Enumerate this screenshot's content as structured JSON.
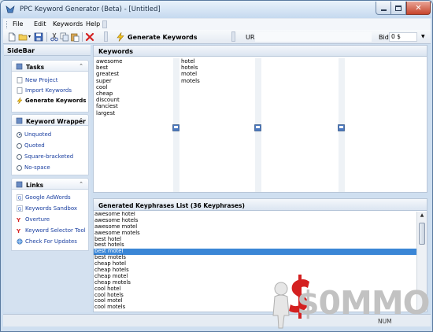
{
  "window": {
    "title": "PPC Keyword Generator (Beta) - [Untitled]"
  },
  "menu": {
    "file": "File",
    "edit": "Edit",
    "keywords": "Keywords",
    "help": "Help"
  },
  "toolbar": {
    "generate_label": "Generate Keywords",
    "url_label": "URL",
    "url_value": "",
    "bid_label": "Bid",
    "bid_value": "0 $"
  },
  "sidebar": {
    "title": "SideBar",
    "tasks": {
      "title": "Tasks",
      "items": [
        "New Project",
        "Import Keywords",
        "Generate Keywords"
      ]
    },
    "wrapper": {
      "title": "Keyword Wrapper",
      "options": [
        "Unquoted",
        "Quoted",
        "Square-bracketed",
        "No-space"
      ],
      "selected": "Unquoted"
    },
    "links": {
      "title": "Links",
      "items": [
        "Google AdWords",
        "Keywords Sandbox",
        "Overture",
        "Keyword Selector Tool",
        "Check For Updates"
      ]
    }
  },
  "keywords": {
    "title": "Keywords",
    "column1": [
      "awesome",
      "best",
      "greatest",
      "super",
      "cool",
      "cheap",
      "discount",
      "fanciest",
      "largest"
    ],
    "column2": [
      "hotel",
      "hotels",
      "motel",
      "motels"
    ]
  },
  "results": {
    "title": "Generated Keyphrases List (36 Keyphrases)",
    "selected": "best motel",
    "items": [
      "awesome hotel",
      "awesome hotels",
      "awesome motel",
      "awesome motels",
      "best hotel",
      "best hotels",
      "best motel",
      "best motels",
      "cheap hotel",
      "cheap hotels",
      "cheap motel",
      "cheap motels",
      "cool hotel",
      "cool hotels",
      "cool motel",
      "cool motels"
    ]
  },
  "status": {
    "text": "NUM"
  },
  "watermark": {
    "text": "$0MMO"
  },
  "colors": {
    "accent": "#3a86d6",
    "link": "#1a3fa0",
    "close": "#c7442c"
  },
  "icons": [
    "app-icon",
    "new-icon",
    "open-icon",
    "save-icon",
    "cut-icon",
    "copy-icon",
    "paste-icon",
    "delete-icon",
    "lightning-icon",
    "page-icon",
    "google-icon",
    "yahoo-icon",
    "globe-icon"
  ]
}
